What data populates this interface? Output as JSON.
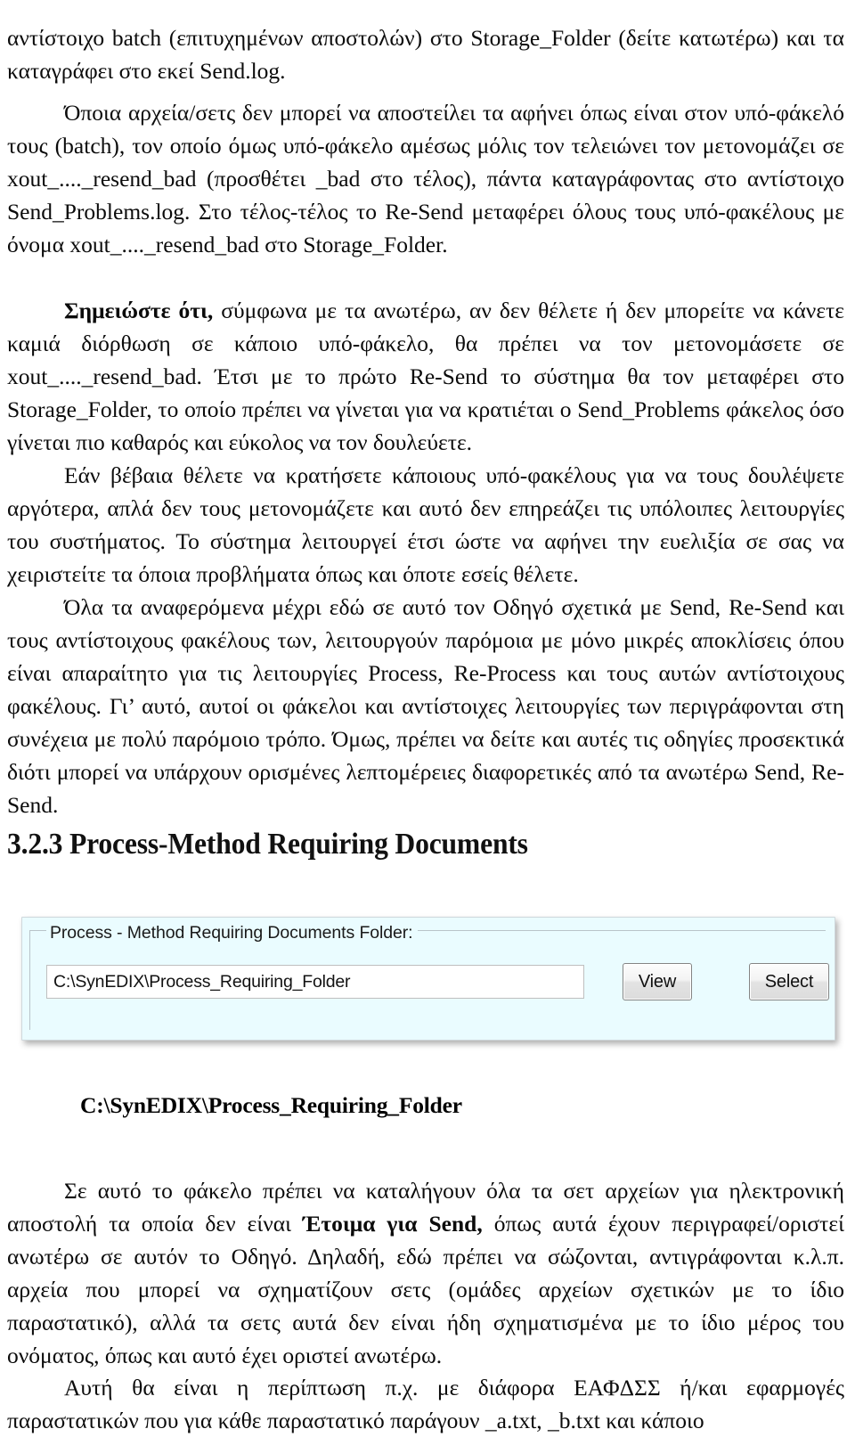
{
  "document": {
    "paragraphs": [
      {
        "id": "p-top-continued",
        "text": "αντίστοιχο batch (επιτυχημένων αποστολών) στο Storage_Folder (δείτε κατωτέρω) και τα καταγράφει στο εκεί Send.log."
      },
      {
        "id": "p-whichever-files",
        "text": "Όποια αρχεία/σετς δεν μπορεί να αποστείλει τα αφήνει όπως είναι στον υπό-φάκελό τους (batch), τον οποίο όμως υπό-φάκελο αμέσως μόλις τον τελειώνει τον μετονομάζει σε xout_...._resend_bad (προσθέτει _bad στο τέλος), πάντα καταγράφοντας στο αντίστοιχο Send_Problems.log.   Στο τέλος-τέλος το Re-Send μεταφέρει όλους τους υπό-φακέλους με όνομα xout_...._resend_bad στο Storage_Folder."
      },
      {
        "id": "p-note",
        "bold_lead": "Σημειώστε ότι,",
        "text": " σύμφωνα με τα ανωτέρω, αν δεν θέλετε ή δεν μπορείτε να κάνετε καμιά διόρθωση σε κάποιο υπό-φάκελο, θα πρέπει να τον μετονομάσετε σε xout_...._resend_bad.   Έτσι με το πρώτο Re-Send το σύστημα θα τον μεταφέρει στο Storage_Folder, το οποίο πρέπει να γίνεται για να κρατιέται ο Send_Problems φάκελος όσο γίνεται πιο καθαρός και εύκολος να τον δουλεύετε."
      },
      {
        "id": "p-if-keep",
        "text": "Εάν βέβαια θέλετε να κρατήσετε κάποιους υπό-φακέλους για να τους δουλέψετε αργότερα, απλά δεν τους μετονομάζετε και αυτό δεν επηρεάζει τις υπόλοιπες λειτουργίες του συστήματος.   Το σύστημα λειτουργεί έτσι ώστε να αφήνει την ευελιξία σε σας να χειριστείτε τα όποια προβλήματα όπως και όποτε εσείς θέλετε."
      },
      {
        "id": "p-all-mentioned",
        "text": "Όλα τα αναφερόμενα μέχρι εδώ σε αυτό τον Οδηγό σχετικά με Send, Re-Send και τους αντίστοιχους φακέλους των, λειτουργούν παρόμοια με μόνο μικρές αποκλίσεις όπου είναι απαραίτητο για τις λειτουργίες Process, Re-Process και τους αυτών αντίστοιχους φακέλους.   Γι’ αυτό, αυτοί οι φάκελοι και αντίστοιχες λειτουργίες των περιγράφονται στη συνέχεια με πολύ παρόμοιο τρόπο.    Όμως, πρέπει να δείτε και αυτές τις οδηγίες προσεκτικά διότι μπορεί να υπάρχουν ορισμένες λεπτομέρειες διαφορετικές από τα ανωτέρω Send, Re-Send."
      }
    ],
    "heading": {
      "id": "heading-3-2-3",
      "text": "3.2.3 Process-Method Requiring Documents"
    },
    "folder_label": {
      "id": "folder-name-heading",
      "text": "C:\\SynEDIX\\Process_Requiring_Folder"
    },
    "paragraphs_after": [
      {
        "id": "p-in-this-folder-a",
        "text": "Σε αυτό το φάκελο πρέπει να καταλήγουν όλα τα σετ αρχείων για ηλεκτρονική αποστολή τα οποία δεν είναι "
      },
      {
        "id": "p-in-this-folder-bold",
        "text": "Έτοιμα για Send,"
      },
      {
        "id": "p-in-this-folder-b",
        "text": " όπως αυτά έχουν περιγραφεί/οριστεί ανωτέρω σε αυτόν το Οδηγό.   Δηλαδή, εδώ πρέπει να σώζονται, αντιγράφονται κ.λ.π. αρχεία που μπορεί να σχηματίζουν σετς (ομάδες αρχείων σχετικών με το ίδιο παραστατικό), αλλά τα σετς αυτά δεν είναι ήδη σχηματισμένα με το ίδιο μέρος του ονόματος, όπως και αυτό έχει οριστεί ανωτέρω."
      },
      {
        "id": "p-this-will-be-case",
        "text": "Αυτή θα είναι η περίπτωση π.χ. με διάφορα ΕΑΦΔΣΣ ή/και εφαρμογές παραστατικών που για κάθε παραστατικό παράγουν _a.txt, _b.txt και κάποιο"
      }
    ]
  },
  "screenshot_panel": {
    "group_legend": "Process - Method Requiring Documents Folder:",
    "path_value": "C:\\SynEDIX\\Process_Requiring_Folder",
    "buttons": {
      "view": "View",
      "select": "Select"
    },
    "colors": {
      "panel_background": "#eafcff",
      "input_background": "#ffffff",
      "button_face": "#e8e8e8",
      "border": "#b9c4c9"
    }
  }
}
